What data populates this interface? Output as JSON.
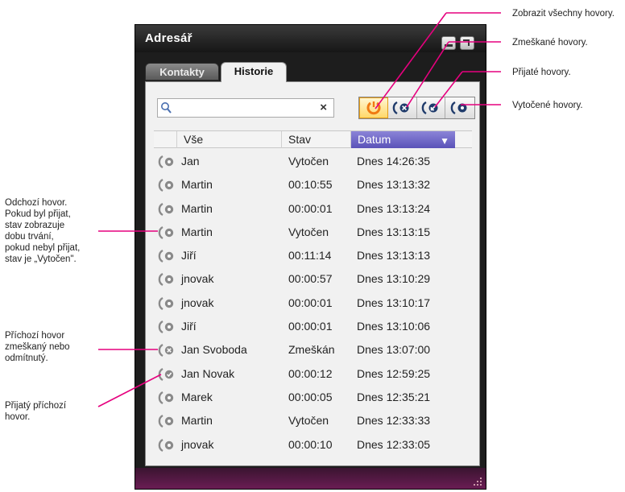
{
  "window": {
    "title": "Adresář"
  },
  "tabs": [
    {
      "label": "Kontakty"
    },
    {
      "label": "Historie"
    }
  ],
  "search": {
    "value": "",
    "clear_glyph": "×"
  },
  "filters": [
    {
      "name": "all-calls",
      "icon": "all-calls-icon",
      "active": true
    },
    {
      "name": "missed-calls",
      "icon": "missed-call-icon",
      "active": false
    },
    {
      "name": "received-calls",
      "icon": "received-call-icon",
      "active": false
    },
    {
      "name": "dialed-calls",
      "icon": "dialed-call-icon",
      "active": false
    }
  ],
  "columns": {
    "all": "Vše",
    "stav": "Stav",
    "datum": "Datum"
  },
  "rows": [
    {
      "type": "outgoing",
      "name": "Jan",
      "stav": "Vytočen",
      "datum": "Dnes 14:26:35"
    },
    {
      "type": "outgoing",
      "name": "Martin",
      "stav": "00:10:55",
      "datum": "Dnes 13:13:32"
    },
    {
      "type": "outgoing",
      "name": "Martin",
      "stav": "00:00:01",
      "datum": "Dnes 13:13:24"
    },
    {
      "type": "outgoing",
      "name": "Martin",
      "stav": "Vytočen",
      "datum": "Dnes 13:13:15"
    },
    {
      "type": "outgoing",
      "name": "Jiří",
      "stav": "00:11:14",
      "datum": "Dnes 13:13:13"
    },
    {
      "type": "outgoing",
      "name": "jnovak",
      "stav": "00:00:57",
      "datum": "Dnes 13:10:29"
    },
    {
      "type": "outgoing",
      "name": "jnovak",
      "stav": "00:00:01",
      "datum": "Dnes 13:10:17"
    },
    {
      "type": "outgoing",
      "name": "Jiří",
      "stav": "00:00:01",
      "datum": "Dnes 13:10:06"
    },
    {
      "type": "missed",
      "name": "Jan Svoboda",
      "stav": "Zmeškán",
      "datum": "Dnes 13:07:00"
    },
    {
      "type": "received",
      "name": "Jan Novak",
      "stav": "00:00:12",
      "datum": "Dnes 12:59:25"
    },
    {
      "type": "outgoing",
      "name": "Marek",
      "stav": "00:00:05",
      "datum": "Dnes 12:35:21"
    },
    {
      "type": "outgoing",
      "name": "Martin",
      "stav": "Vytočen",
      "datum": "Dnes 12:33:33"
    },
    {
      "type": "outgoing",
      "name": "jnovak",
      "stav": "00:00:10",
      "datum": "Dnes 12:33:05"
    }
  ],
  "annotations": {
    "all_calls": "Zobrazit všechny hovory.",
    "missed_calls": "Zmeškané hovory.",
    "received_calls": "Přijaté hovory.",
    "dialed_calls": "Vytočené hovory.",
    "outgoing_call": [
      "Odchozí hovor.",
      "Pokud byl přijat,",
      "stav zobrazuje",
      "dobu trvání,",
      "pokud nebyl přijat,",
      "stav je „Vytočen\"."
    ],
    "missed_incoming": [
      "Příchozí hovor",
      "zmeškaný nebo",
      "odmítnutý."
    ],
    "received_incoming": [
      "Přijatý příchozí",
      "hovor."
    ]
  },
  "colors": {
    "accent_line": "#e6007e",
    "header_selected": "#5a52b8",
    "active_filter": "#ffd86a",
    "bottom_bar": "#6a1d54"
  }
}
